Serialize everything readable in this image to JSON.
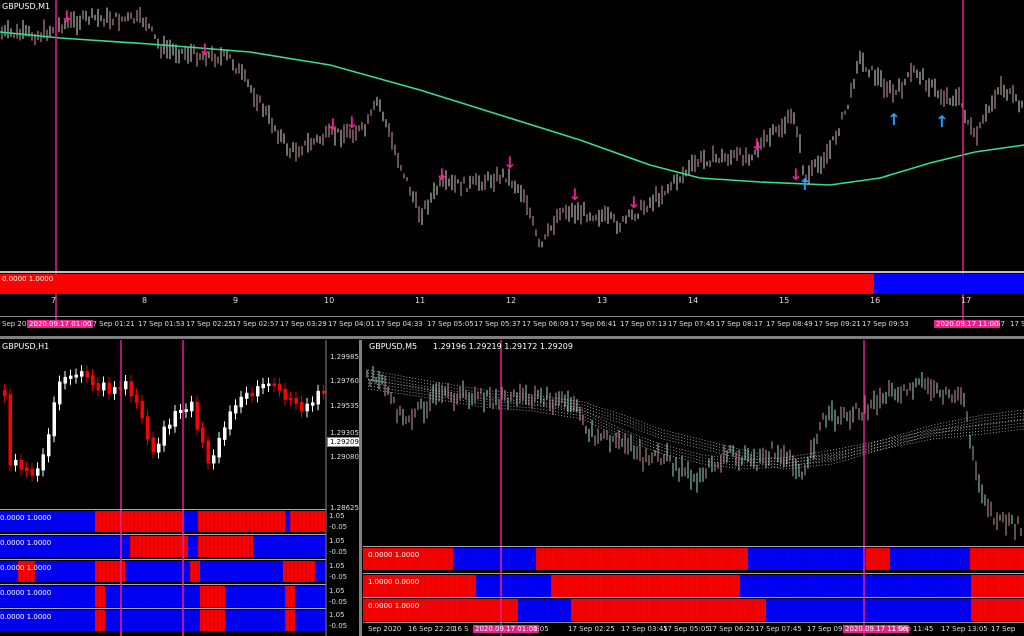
{
  "top": {
    "symbol": "GBPUSD,M1",
    "indicator_label": "0.0000 1.0000",
    "numbers": [
      "7",
      "8",
      "9",
      "10",
      "11",
      "12",
      "13",
      "14",
      "15",
      "16",
      "17"
    ],
    "time_labels": [
      "Sep 202",
      "2020.09.17 01:00",
      "17 Sep 01:21",
      "17 Sep 01:53",
      "17 Sep 02:25",
      "17 Sep 02:57",
      "17 Sep 03:29",
      "17 Sep 04:01",
      "17 Sep 04:33",
      "17 Sep 05:05",
      "17 Sep 05:37",
      "17 Sep 06:09",
      "17 Sep 06:41",
      "17 Sep 07:13",
      "17 Sep 07:45",
      "17 Sep 08:17",
      "17 Sep 08:49",
      "17 Sep 09:21",
      "17 Sep 09:53",
      "2020.09.17 11:00",
      "57",
      "17 Sep"
    ]
  },
  "h1": {
    "symbol": "GBPUSD,H1",
    "prices": [
      "1.29985",
      "1.29760",
      "1.29535",
      "1.29305",
      "1.29209",
      "1.29080",
      "1.28625"
    ],
    "current_price": "1.29209",
    "sub_labels": [
      "0.0000 1.0000",
      "0.0000 1.0000",
      "0.0000 1.0000",
      "0.0000 1.0000",
      "0.0000 1.0000"
    ],
    "sub_scale": [
      "1.05",
      "1.05",
      "1.05",
      "1.05",
      "1.05"
    ],
    "sub_scale_low": [
      "-0.05",
      "-0.05",
      "-0.05",
      "-0.05",
      "-0.05"
    ]
  },
  "m5": {
    "symbol": "GBPUSD,M5",
    "quote": "1.29196 1.29219 1.29172 1.29209",
    "sub_labels": [
      "0.0000 1.0000",
      "1.0000 0.0000",
      "0.0000 1.0000"
    ],
    "time_labels": [
      "Sep 2020",
      "16 Sep 22:20",
      "16 S",
      "2020.09.17 01:00",
      "1:05",
      "17 Sep 02:25",
      "17 Sep 03:45",
      "17 Sep 05:05",
      "17 Sep 06:25",
      "17 Sep 07:45",
      "17 Sep 09:05",
      "2020.09.17 11:00",
      "7 Sep 11:45",
      "17 Sep 13:05",
      "17 Sep"
    ]
  },
  "colors": {
    "up": "#0000ff",
    "down": "#ff0000",
    "ma": "#32e08c",
    "vline": "#e6208c",
    "sell_arrow": "#e6208c",
    "buy_arrow": "#1ea0ff"
  }
}
